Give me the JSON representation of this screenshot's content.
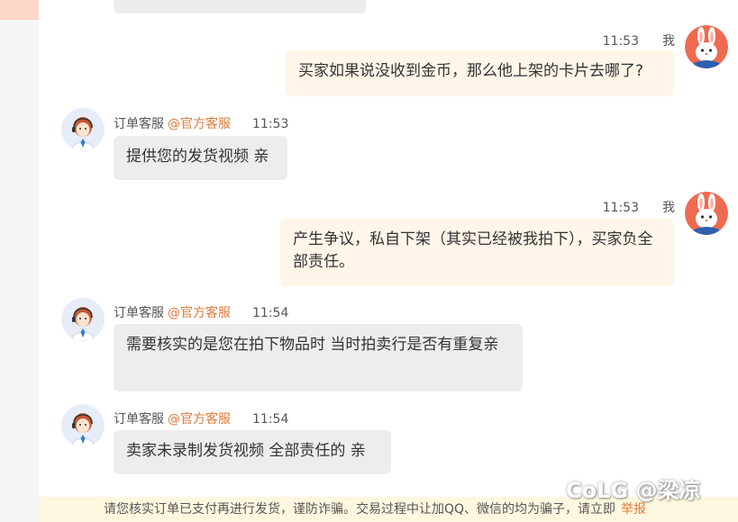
{
  "me_label": "我",
  "agent": {
    "name": "订单客服",
    "tag": "@官方客服"
  },
  "messages": [
    {
      "from": "me",
      "time": "11:53",
      "text": "买家如果说没收到金币，那么他上架的卡片去哪了?"
    },
    {
      "from": "agent",
      "time": "11:53",
      "text": "提供您的发货视频 亲"
    },
    {
      "from": "me",
      "time": "11:53",
      "text": "产生争议，私自下架（其实已经被我拍下），买家负全部责任。"
    },
    {
      "from": "agent",
      "time": "11:54",
      "text": "需要核实的是您在拍下物品时  当时拍卖行是否有重复亲"
    },
    {
      "from": "agent",
      "time": "11:54",
      "text": "卖家未录制发货视频  全部责任的 亲"
    }
  ],
  "footer": {
    "notice": "请您核实订单已支付再进行发货，谨防诈骗。交易过程中让加QQ、微信的均为骗子，请立即",
    "report": "举报"
  },
  "watermark": "CoLG @梁凉",
  "colors": {
    "accent": "#e07a3a",
    "my_bubble": "#fff5e8",
    "agent_bubble": "#ededed",
    "footer_bg": "#fff8e0"
  }
}
